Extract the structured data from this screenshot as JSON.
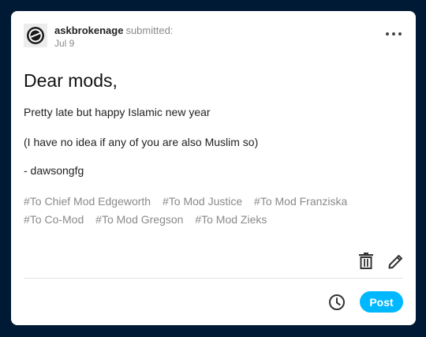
{
  "post": {
    "username": "askbrokenage",
    "action": "submitted:",
    "date": "Jul 9",
    "title": "Dear mods,",
    "paragraphs": [
      "Pretty late but happy Islamic new year",
      "(I have no idea if any of you are also Muslim so)",
      "- dawsongfg"
    ],
    "tags": [
      "#To Chief Mod Edgeworth",
      "#To Mod Justice",
      "#To Mod Franziska",
      "#To Co-Mod",
      "#To Mod Gregson",
      "#To Mod Zieks"
    ]
  },
  "actions": {
    "post_label": "Post"
  },
  "icons": {
    "more": "more-horizontal-icon",
    "delete": "trash-icon",
    "edit": "pencil-icon",
    "schedule": "clock-icon"
  },
  "colors": {
    "background": "#001935",
    "card": "#ffffff",
    "accent": "#00b8ff",
    "tag_text": "#8a8a8a"
  }
}
